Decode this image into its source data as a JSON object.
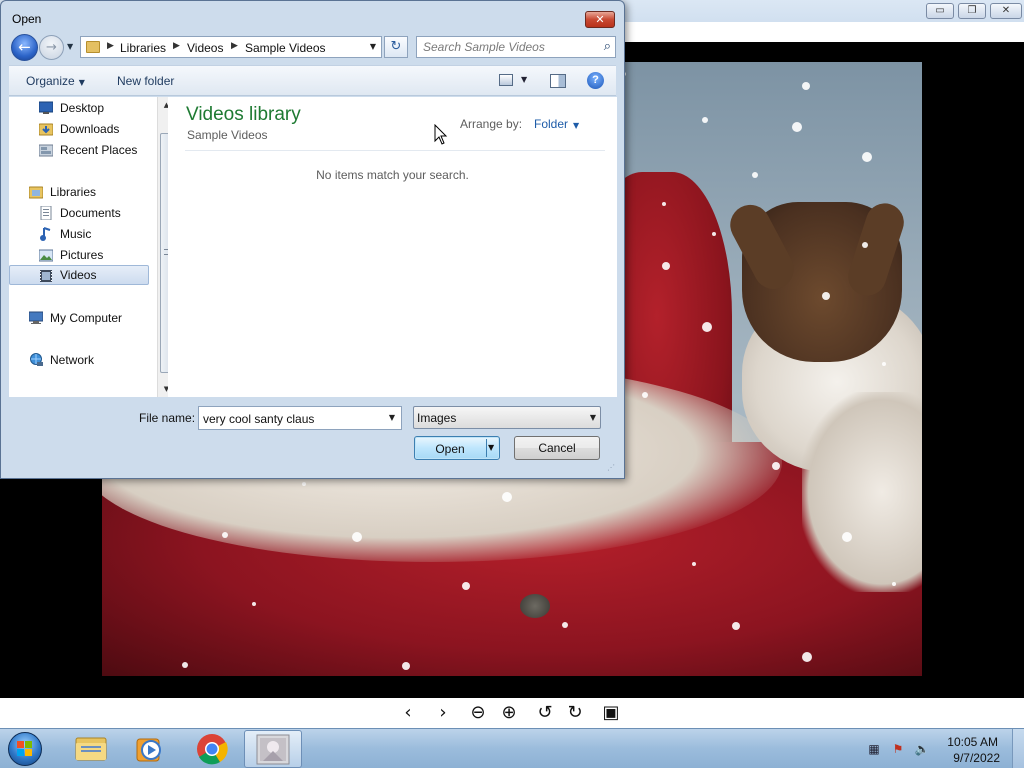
{
  "viewer": {
    "title_buttons": {
      "minimize": "▭",
      "restore": "❐",
      "close": "✕"
    },
    "toolbar": [
      {
        "name": "previous-icon",
        "glyph": "‹"
      },
      {
        "name": "next-icon",
        "glyph": "›"
      },
      {
        "name": "zoom-out-icon",
        "glyph": "⊖"
      },
      {
        "name": "zoom-in-icon",
        "glyph": "⊕"
      },
      {
        "name": "rotate-left-icon",
        "glyph": "↺"
      },
      {
        "name": "rotate-right-icon",
        "glyph": "↻"
      },
      {
        "name": "gallery-icon",
        "glyph": "▣"
      }
    ]
  },
  "dialog": {
    "title": "Open",
    "close_glyph": "✕",
    "nav": {
      "back_glyph": "←",
      "forward_glyph": "→",
      "recent_glyph": "▼",
      "refresh_glyph": "↻"
    },
    "breadcrumb": [
      "Libraries",
      "Videos",
      "Sample Videos"
    ],
    "breadcrumb_sep": "▶",
    "search_placeholder": "Search Sample Videos",
    "commands": {
      "organize": "Organize",
      "new_folder": "New folder",
      "help": "?"
    },
    "nav_pane": {
      "items": [
        {
          "label": "Desktop",
          "icon": "desktop-icon",
          "indent": 1,
          "selected": false
        },
        {
          "label": "Downloads",
          "icon": "downloads-folder-icon",
          "indent": 1,
          "selected": false
        },
        {
          "label": "Recent Places",
          "icon": "recent-places-icon",
          "indent": 1,
          "selected": false
        },
        {
          "label": "Libraries",
          "icon": "libraries-icon",
          "indent": 0,
          "selected": false
        },
        {
          "label": "Documents",
          "icon": "documents-icon",
          "indent": 1,
          "selected": false
        },
        {
          "label": "Music",
          "icon": "music-icon",
          "indent": 1,
          "selected": false
        },
        {
          "label": "Pictures",
          "icon": "pictures-icon",
          "indent": 1,
          "selected": false
        },
        {
          "label": "Videos",
          "icon": "videos-icon",
          "indent": 1,
          "selected": true
        },
        {
          "label": "My Computer",
          "icon": "computer-icon",
          "indent": 0,
          "selected": false
        },
        {
          "label": "Network",
          "icon": "network-icon",
          "indent": 0,
          "selected": false
        }
      ]
    },
    "content": {
      "library_title": "Videos library",
      "library_subtitle": "Sample Videos",
      "arrange_label": "Arrange by:",
      "arrange_value": "Folder",
      "empty_message": "No items match your search."
    },
    "footer": {
      "file_name_label": "File name:",
      "file_name_value": "very cool santy claus",
      "file_type": "Images",
      "open_label": "Open",
      "cancel_label": "Cancel"
    }
  },
  "taskbar": {
    "items": [
      {
        "name": "taskbar-explorer",
        "active": false
      },
      {
        "name": "taskbar-media-player",
        "active": false
      },
      {
        "name": "taskbar-chrome",
        "active": false
      },
      {
        "name": "taskbar-photo-viewer",
        "active": true
      }
    ],
    "clock": {
      "time": "10:05 AM",
      "date": "9/7/2022"
    },
    "tray": [
      {
        "name": "network-tray-icon",
        "glyph": "▦"
      },
      {
        "name": "action-center-tray-icon",
        "glyph": "⚑"
      },
      {
        "name": "volume-tray-icon",
        "glyph": "🔈"
      }
    ]
  }
}
